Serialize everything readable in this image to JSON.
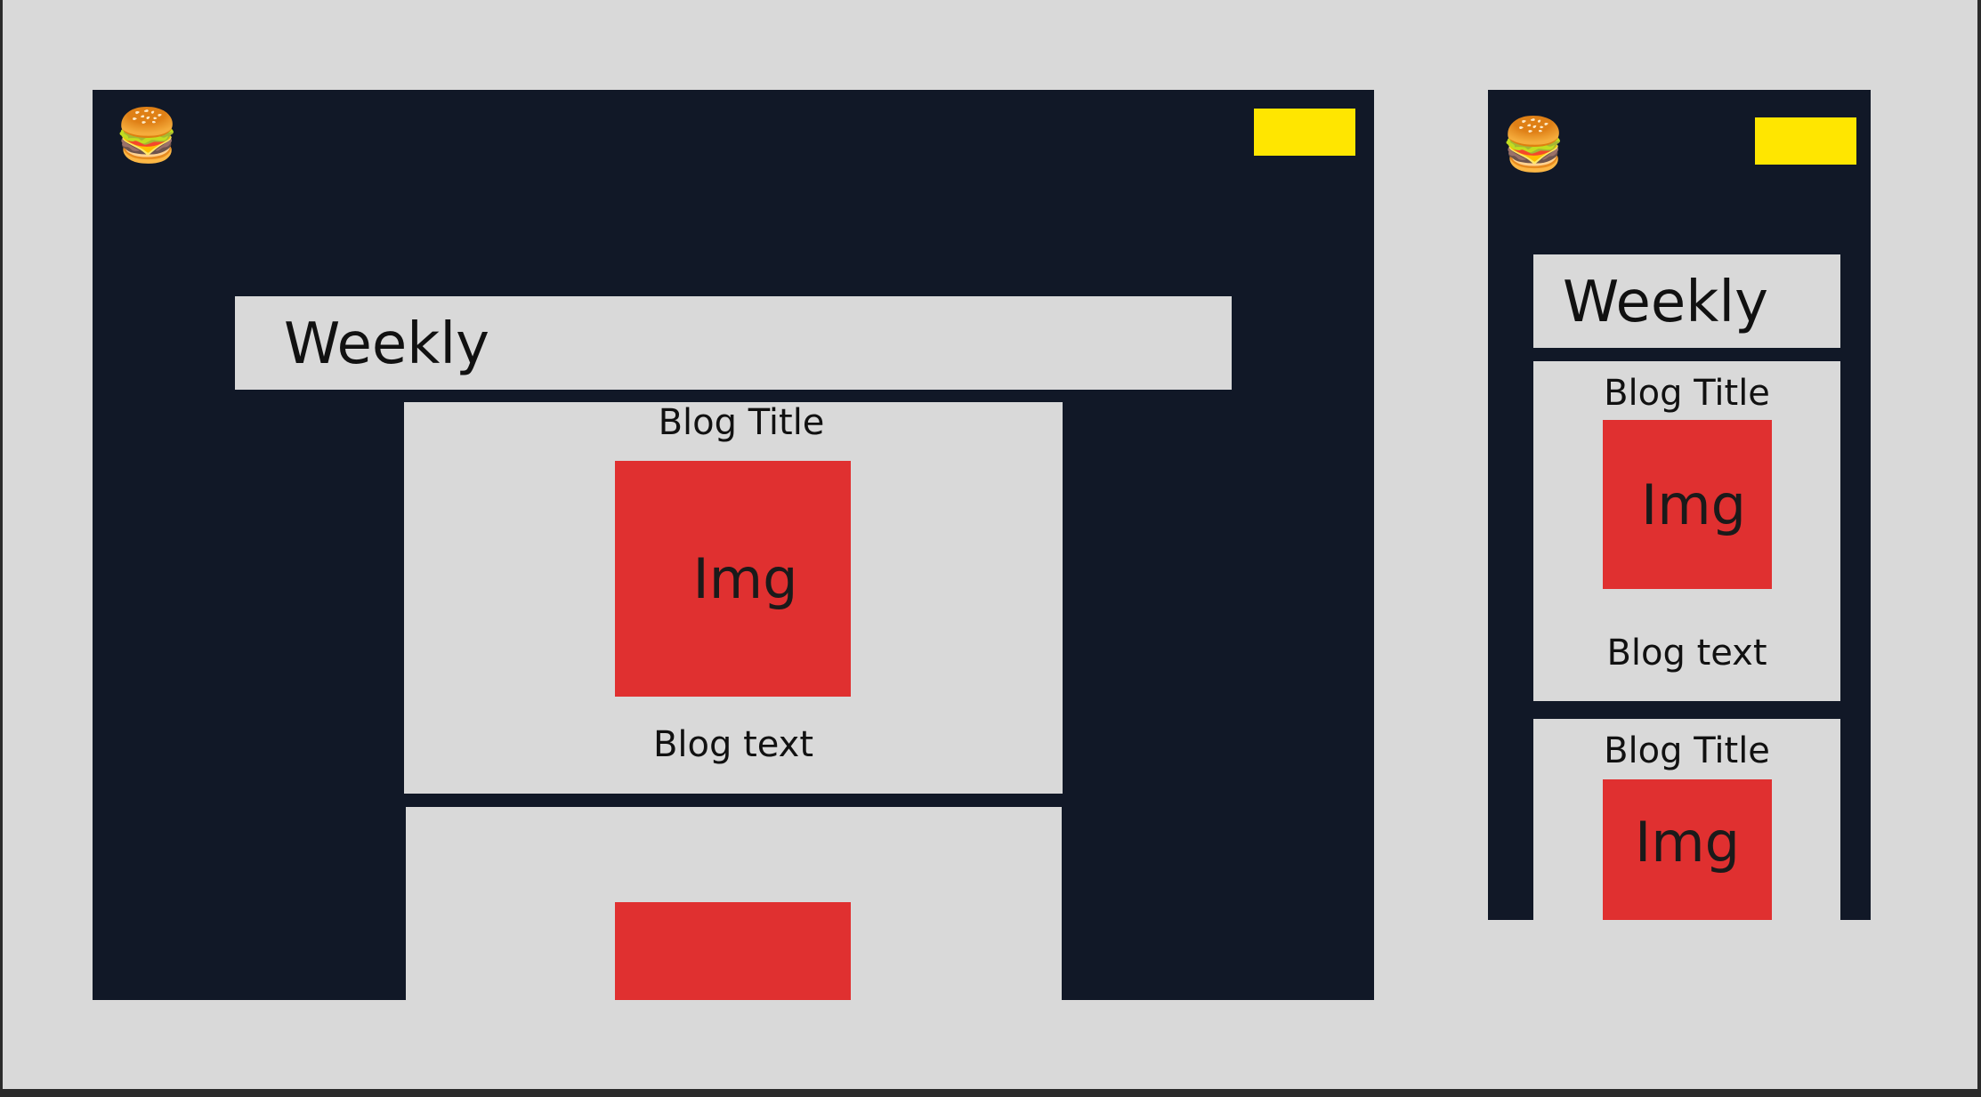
{
  "colors": {
    "page_background": "#d9d9d9",
    "frame_background": "#111827",
    "cta_button": "#ffe600",
    "image_placeholder": "#e03030",
    "card_background": "#d9d9d9"
  },
  "desktop": {
    "menu_icon": "🍔",
    "banner_title": "Weekly",
    "posts": [
      {
        "title": "Blog Title",
        "image_label": "Img",
        "text": "Blog text"
      },
      {
        "title": "",
        "image_label": "",
        "text": ""
      }
    ]
  },
  "mobile": {
    "menu_icon": "🍔",
    "banner_title": "Weekly",
    "posts": [
      {
        "title": "Blog Title",
        "image_label": "Img",
        "text": "Blog text"
      },
      {
        "title": "Blog Title",
        "image_label": "Img",
        "text": ""
      }
    ]
  }
}
